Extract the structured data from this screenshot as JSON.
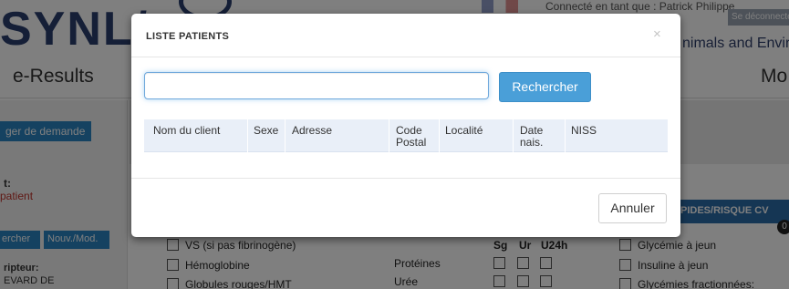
{
  "background": {
    "logo_text": "SYNL/",
    "connected_text": "Connecté en tant que : Patrick Philippe",
    "logout_label": "Se déconnecter",
    "subtitle": "nimals and Enviro",
    "app_title": "e-Results",
    "right_title": "Mo",
    "sidebar": {
      "demande_button": "ger de demande",
      "label_t": "t:",
      "patient_label": "patient",
      "search_button": "ercher",
      "new_mod_button": "Nouv./Mod.",
      "prescriber_label": "ripteur:",
      "prescriber_value": "EVARD DE"
    },
    "form": {
      "col_headers": [
        "Sg",
        "Ur",
        "U24h"
      ],
      "left_items": [
        "VS (si pas fibrinogène)",
        "Hémoglobine",
        "Globules rouges/HMT"
      ],
      "middle_items": [
        "Protéines",
        "Urée"
      ],
      "risk_header": "PIDES/RISQUE CV",
      "badge": "0",
      "right_items": [
        "Glycémie à jeun",
        "Insuline à jeun",
        "Glycémies fractionnées:"
      ]
    }
  },
  "modal": {
    "title": "LISTE PATIENTS",
    "close_glyph": "×",
    "search": {
      "value": "",
      "placeholder": ""
    },
    "search_button": "Rechercher",
    "columns": [
      "Nom du client",
      "Sexe",
      "Adresse",
      "Code Postal",
      "Localité",
      "Date nais.",
      "NISS"
    ],
    "rows": [],
    "cancel_button": "Annuler"
  },
  "colors": {
    "primary": "#4a9fd8",
    "table_header_bg": "#e9eff8",
    "overlay": "rgba(0,0,0,0.5)",
    "brand_dark": "#2a3f6e",
    "alert_red": "#c0322b"
  }
}
